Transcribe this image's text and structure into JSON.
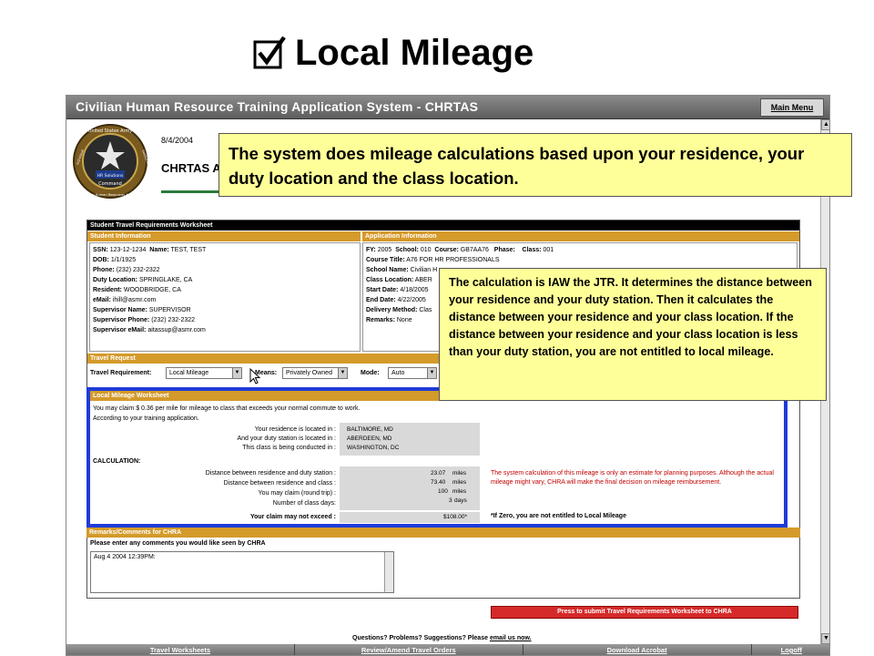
{
  "slide": {
    "title": "Local Mileage",
    "checkbox_icon": "checked-box-icon"
  },
  "app": {
    "title": "Civilian Human Resource Training Application System - CHRTAS",
    "main_menu": "Main Menu",
    "date": "8/4/2004",
    "heading": "CHRTAS A",
    "logo_text": {
      "top": "United States Army",
      "middle": "HR Solutions",
      "lower": "Command",
      "bottom": "Civilian Human Resources Agency",
      "left": "Individual",
      "right": "Institution"
    }
  },
  "callouts": {
    "main": "The system does mileage calculations based upon your residence, your duty location and the class location.",
    "detail": "The calculation is IAW the JTR.  It determines the distance between your residence and your duty station.  Then it calculates the distance between your residence and your class location.  If the distance between your residence and your class location is less than your duty station, you are not entitled to local mileage."
  },
  "worksheet": {
    "title": "Student Travel Requirements Worksheet",
    "student_info": {
      "header": "Student Information",
      "fields": [
        {
          "label": "SSN:",
          "value": "123-12-1234"
        },
        {
          "label": "Name:",
          "value": "TEST, TEST"
        },
        {
          "label": "DOB:",
          "value": "1/1/1925"
        },
        {
          "label": "Phone:",
          "value": "(232) 232-2322"
        },
        {
          "label": "Duty Location:",
          "value": "SPRINGLAKE, CA"
        },
        {
          "label": "Resident:",
          "value": "WOODBRIDGE, CA"
        },
        {
          "label": "eMail:",
          "value": "ihill@asmr.com"
        },
        {
          "label": "Supervisor Name:",
          "value": "SUPERVISOR"
        },
        {
          "label": "Supervisor Phone:",
          "value": "(232) 232-2322"
        },
        {
          "label": "Supervisor eMail:",
          "value": "aitassup@asmr.com"
        }
      ]
    },
    "application_info": {
      "header": "Application Information",
      "fields": [
        {
          "label": "FY:",
          "value": "2005"
        },
        {
          "label": "School:",
          "value": "010"
        },
        {
          "label": "Course:",
          "value": "GB7AA76"
        },
        {
          "label": "Phase:",
          "value": ""
        },
        {
          "label": "Class:",
          "value": "001"
        },
        {
          "label": "Course Title:",
          "value": "A76 FOR HR PROFESSIONALS"
        },
        {
          "label": "School Name:",
          "value": "Civilian H"
        },
        {
          "label": "Class Location:",
          "value": "ABER"
        },
        {
          "label": "Start Date:",
          "value": "4/18/2005"
        },
        {
          "label": "End Date:",
          "value": "4/22/2005"
        },
        {
          "label": "Delivery Method:",
          "value": "Clas"
        },
        {
          "label": "Remarks:",
          "value": "None"
        }
      ]
    },
    "travel_request": {
      "header": "Travel Request",
      "requirement_label": "Travel Requirement:",
      "requirement_value": "Local Mileage",
      "means_label": "Means:",
      "means_value": "Privately Owned",
      "mode_label": "Mode:",
      "mode_value": "Auto"
    },
    "local_mileage": {
      "header": "Local Mileage Worksheet",
      "intro_1": "You may claim $ 0.36 per mile for mileage to class that exceeds your normal commute to work.",
      "intro_2": "According to your training application.",
      "residence_label": "Your residence is located in :",
      "residence_value": "BALTIMORE, MD",
      "duty_label": "And your duty station is located in :",
      "duty_value": "ABERDEEN, MD",
      "class_label": "This class is being conducted in :",
      "class_value": "WASHINGTON, DC",
      "calculation_label": "CALCULATION:",
      "dist_duty_label": "Distance between residence and duty station :",
      "dist_duty_value": "23.07",
      "dist_class_label": "Distance between residence and class :",
      "dist_class_value": "73.40",
      "claim_label": "You may claim (round trip) :",
      "claim_value": "100",
      "miles_unit": "miles",
      "days_label": "Number of class days:",
      "days_value": "3",
      "days_unit": "days",
      "not_exceed_label": "Your claim may not exceed :",
      "not_exceed_value": "$108.00*",
      "disclaimer": "The system calculation of this mileage is only an estimate for planning purposes. Although the actual mileage might vary, CHRA will make the final decision on mileage reimbursement.",
      "zero_note": "*If Zero, you are not entitled to Local Mileage"
    },
    "remarks": {
      "header": "Remarks/Comments for CHRA",
      "label": "Please enter any comments you would like seen by CHRA",
      "value": "Aug  4 2004 12:39PM:"
    }
  },
  "submit_button": "Press to submit Travel Requirements Worksheet to CHRA",
  "help": {
    "prefix": "Questions? Problems? Suggestions?  Please ",
    "link": "email us now."
  },
  "bottom_nav": [
    "Travel Worksheets",
    "Review/Amend Travel Orders",
    "Download Acrobat",
    "Logoff"
  ],
  "colors": {
    "callout": "#ffff99",
    "section_header": "#d49a2a",
    "highlight_border": "#1f3bd9",
    "submit": "#d62a2a",
    "disclaimer": "#c00000"
  }
}
